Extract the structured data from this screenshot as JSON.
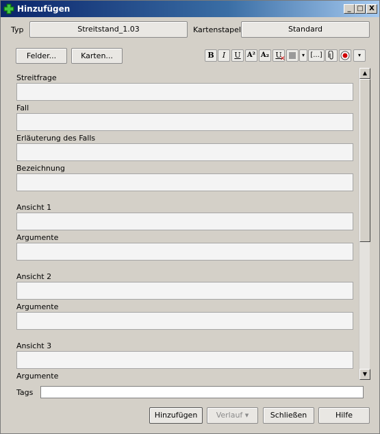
{
  "window": {
    "title": "Hinzufügen"
  },
  "titlebar_buttons": {
    "minimize": "_",
    "maximize": "□",
    "close": "X"
  },
  "header": {
    "type_label": "Typ",
    "type_value": "Streitstand_1.03",
    "deck_label": "Kartenstapel",
    "deck_value": "Standard"
  },
  "toolbar": {
    "fields_button": "Felder...",
    "cards_button": "Karten...",
    "format_buttons": [
      "B",
      "I",
      "U",
      "A²",
      "A₂",
      "U",
      "",
      "▾",
      "[...]",
      "",
      "",
      "▾"
    ]
  },
  "fields": [
    {
      "label": "Streitfrage",
      "value": ""
    },
    {
      "label": "Fall",
      "value": ""
    },
    {
      "label": "Erläuterung des Falls",
      "value": ""
    },
    {
      "label": "Bezeichnung",
      "value": ""
    },
    {
      "label": "Ansicht 1",
      "value": ""
    },
    {
      "label": "Argumente",
      "value": ""
    },
    {
      "label": "Ansicht 2",
      "value": ""
    },
    {
      "label": "Argumente",
      "value": ""
    },
    {
      "label": "Ansicht 3",
      "value": ""
    },
    {
      "label": "Argumente",
      "value": ""
    }
  ],
  "tags": {
    "label": "Tags",
    "value": ""
  },
  "footer": {
    "add_button": "Hinzufügen",
    "history_button": "Verlauf ▾",
    "close_button": "Schließen",
    "help_button": "Hilfe"
  },
  "colors": {
    "accent": "#0a246a",
    "window_bg": "#d4d0c8",
    "field_bg": "#f4f4f4",
    "record_red": "#d00000"
  },
  "icons": [
    "add-plus-icon",
    "paperclip-icon",
    "record-icon",
    "scroll-up-icon",
    "scroll-down-icon"
  ]
}
